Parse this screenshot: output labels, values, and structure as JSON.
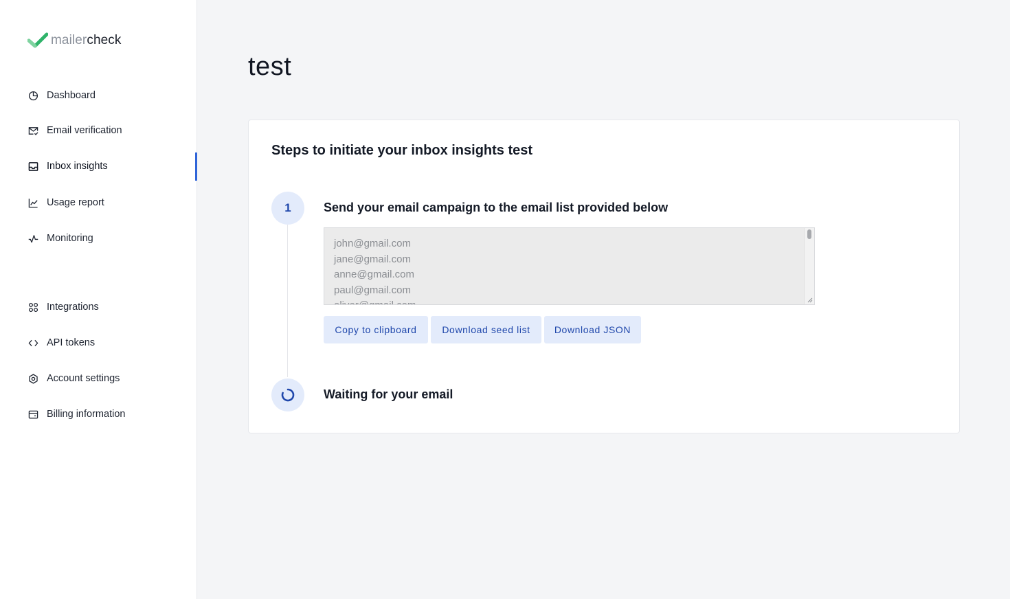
{
  "brand": {
    "light": "mailer",
    "dark": "check"
  },
  "sidebar": {
    "items": [
      {
        "label": "Dashboard",
        "icon": "pie-chart-icon"
      },
      {
        "label": "Email verification",
        "icon": "mail-check-icon"
      },
      {
        "label": "Inbox insights",
        "icon": "inbox-icon",
        "active": true
      },
      {
        "label": "Usage report",
        "icon": "line-chart-icon"
      },
      {
        "label": "Monitoring",
        "icon": "activity-icon"
      },
      {
        "label": "Integrations",
        "icon": "grid-icon"
      },
      {
        "label": "API tokens",
        "icon": "code-icon"
      },
      {
        "label": "Account settings",
        "icon": "gear-icon"
      },
      {
        "label": "Billing information",
        "icon": "credit-card-icon"
      }
    ]
  },
  "main": {
    "title": "test",
    "card": {
      "title": "Steps to initiate your inbox insights test",
      "step1": {
        "number": "1",
        "title": "Send your email campaign to the email list provided below",
        "emails": [
          "john@gmail.com",
          "jane@gmail.com",
          "anne@gmail.com",
          "paul@gmail.com",
          "oliver@gmail.com"
        ],
        "buttons": {
          "copy": "Copy to clipboard",
          "seed": "Download seed list",
          "json": "Download JSON"
        }
      },
      "step2": {
        "title": "Waiting for your email"
      }
    }
  },
  "colors": {
    "accent": "#2f64d8",
    "button_bg": "#e3ebfb",
    "button_text": "#1f47ab",
    "logo_green": "#2fb36a"
  }
}
